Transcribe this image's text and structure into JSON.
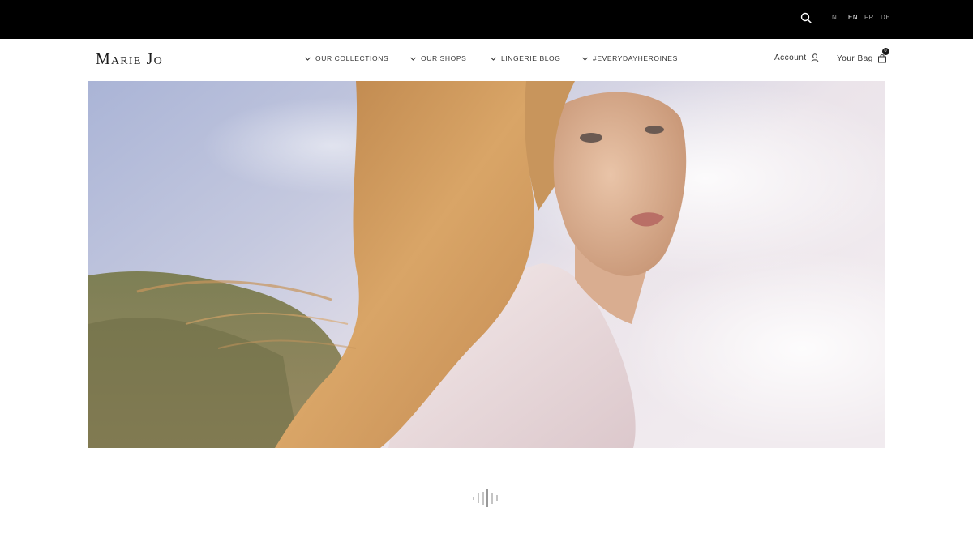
{
  "brand": {
    "logo_text": "Marie Jo"
  },
  "topbar": {
    "search_icon": "search-icon",
    "languages": [
      {
        "code": "NL",
        "active": false
      },
      {
        "code": "EN",
        "active": true
      },
      {
        "code": "FR",
        "active": false
      },
      {
        "code": "DE",
        "active": false
      }
    ]
  },
  "nav": {
    "items": [
      {
        "label": "OUR COLLECTIONS"
      },
      {
        "label": "OUR SHOPS"
      },
      {
        "label": "LINGERIE BLOG"
      },
      {
        "label": "#EVERYDAYHEROINES"
      }
    ]
  },
  "account": {
    "label": "Account",
    "icon": "user-icon"
  },
  "bag": {
    "label": "Your Bag",
    "icon": "shopping-bag-icon",
    "count": "0"
  },
  "hero": {
    "icon": "hero-video"
  },
  "loader": {
    "icon": "audio-wave-loader-icon"
  },
  "colors": {
    "topbar": "#000000",
    "text": "#333333",
    "background": "#ffffff"
  }
}
